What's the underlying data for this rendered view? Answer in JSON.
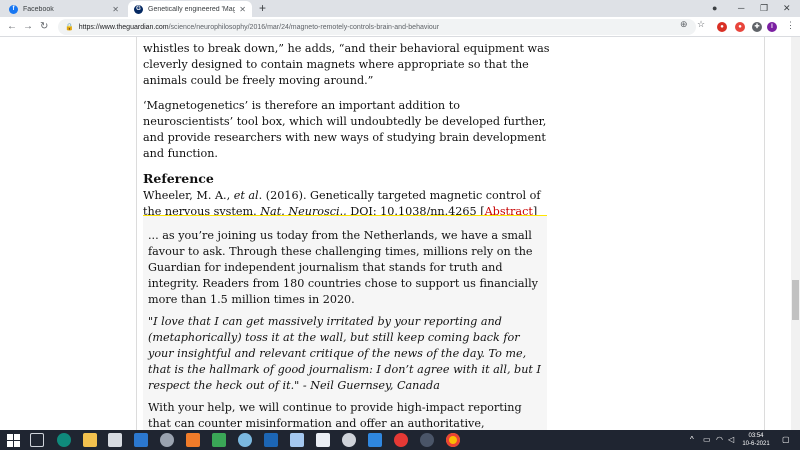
{
  "browser": {
    "tabs": [
      {
        "title": "Facebook",
        "icon": "facebook-icon"
      },
      {
        "title": "Genetically engineered 'Magneto...",
        "icon": "guardian-icon"
      }
    ],
    "new_tab": "+",
    "url_host": "https://www.theguardian.com",
    "url_path": "/science/neurophilosophy/2016/mar/24/magneto-remotely-controls-brain-and-behaviour",
    "profile_initial": "I"
  },
  "article": {
    "p1": "whistles to break down,” he adds, “and their behavioral equipment was cleverly designed to contain magnets where appropriate so that the animals could be freely moving around.”",
    "p2": "‘Magnetogenetics’ is therefore an important addition to neuroscientists’ tool box, which will undoubtedly be developed further, and provide researchers with new ways of studying brain development and function.",
    "reference_heading": "Reference",
    "reference_authors": "Wheeler, M. A., ",
    "reference_etal": "et al",
    "reference_mid": ". (2016). Genetically targeted magnetic control of the nervous system. ",
    "reference_journal": "Nat. Neurosci",
    "reference_tail": "., DOI: 10.1038/nn.4265 [",
    "reference_link": "Abstract",
    "reference_close": "]"
  },
  "epic": {
    "intro": "... as you’re joining us today from the Netherlands, we have a small favour to ask. Through these challenging times, millions rely on the Guardian for independent journalism that stands for truth and integrity. Readers from 180 countries chose to support us financially more than 1.5 million times in 2020.",
    "quote": "\"I love that I can get massively irritated by your reporting and (metaphorically) toss it at the wall, but still keep coming back for your insightful and relevant critique of the news of the day. To me, that is the hallmark of good journalism: I don’t agree with it all, but I respect the heck out of it.\" - Neil Guernsey, Canada",
    "outro": "With your help, we will continue to provide high-impact reporting that can counter misinformation and offer an authoritative, trustworthy source of"
  },
  "taskbar": {
    "time": "03:54",
    "date": "10-6-2021"
  },
  "colors": {
    "accent_link": "#c70000",
    "epic_border": "#ffe500",
    "taskbar": "#1f2531"
  }
}
